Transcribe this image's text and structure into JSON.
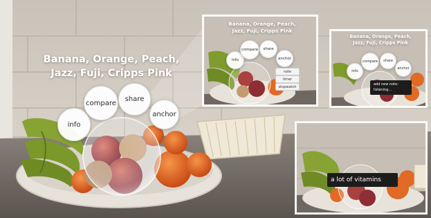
{
  "main": {
    "title": "Banana, Orange, Peach,\nJazz, Fuji, Cripps Pink",
    "buttons": {
      "info": "info",
      "compare": "compare",
      "share": "share",
      "anchor": "anchor"
    }
  },
  "panel_top_middle": {
    "title": "Banana, Orange, Peach,\nJazz, Fuji, Cripps Pink",
    "buttons": {
      "info": "info",
      "compare": "compare",
      "share": "share",
      "anchor": "anchor"
    },
    "menu": [
      "note",
      "timer",
      "stopwatch"
    ]
  },
  "panel_top_right": {
    "title": "Banana, Orange, Peach,\nJazz, Fuji, Cripps Pink",
    "buttons": {
      "info": "info",
      "compare": "compare",
      "share": "share",
      "anchor": "anchor"
    },
    "note_line1": "add new note:",
    "note_line2": "listening..."
  },
  "panel_bottom_right": {
    "note_text": "a lot of vitamins"
  },
  "colors": {
    "wall": "#cfc7bd",
    "counter": "#6f6862",
    "bowl": "#eeeae2",
    "banana": "#7c9a2c",
    "orange": "#e0621e",
    "apple": "#a7343a",
    "bubble": "#ffffff",
    "note_bg": "#1c1c1c"
  }
}
